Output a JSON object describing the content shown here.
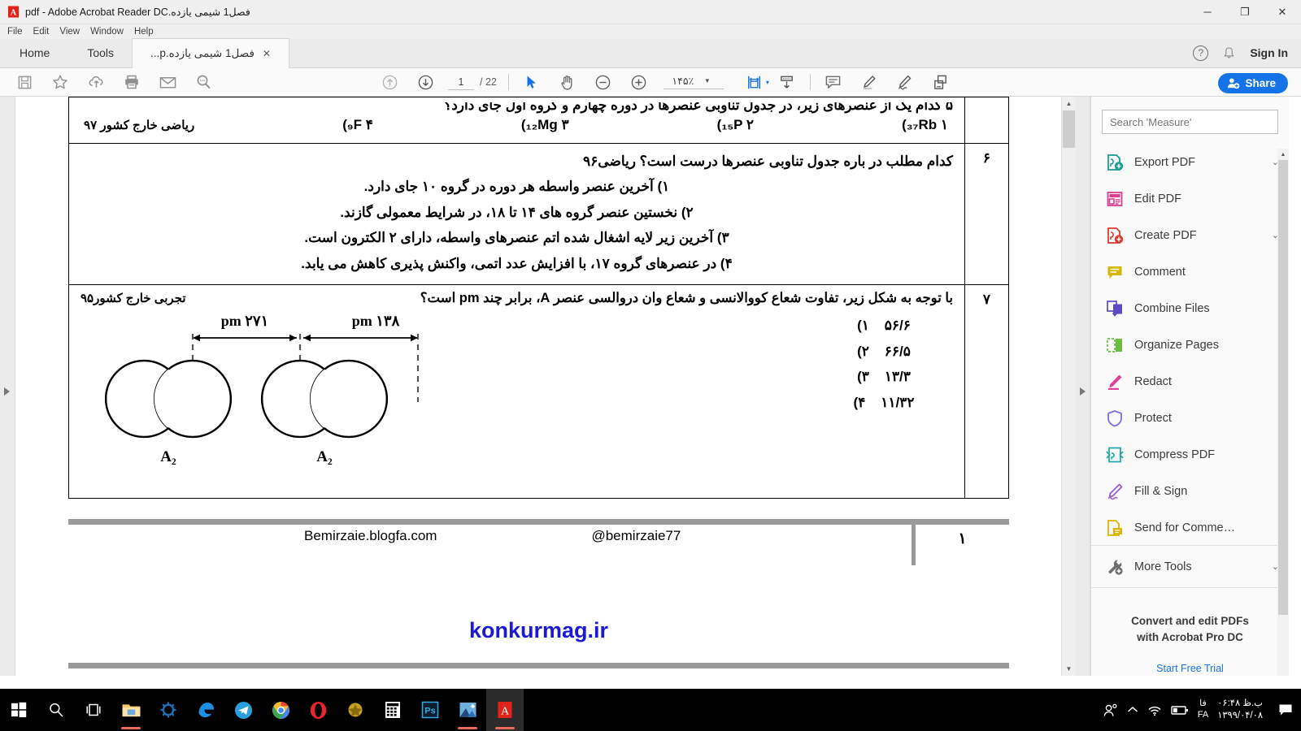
{
  "window": {
    "title": "فصل1 شیمی یازده.pdf - Adobe Acrobat Reader DC",
    "app_icon": "acrobat-icon",
    "minimize": "─",
    "maximize": "❐",
    "close": "✕"
  },
  "menubar": {
    "items": [
      "File",
      "Edit",
      "View",
      "Window",
      "Help"
    ]
  },
  "tabs": {
    "home": "Home",
    "tools": "Tools",
    "document": "فصل1 شیمی یازده.p...",
    "close_glyph": "✕",
    "help_glyph": "?",
    "bell_glyph": "🔔",
    "sign_in": "Sign In"
  },
  "toolbar": {
    "left_icons": [
      "save-icon",
      "star-icon",
      "cloud-upload-icon",
      "print-icon",
      "email-icon",
      "search-icon"
    ],
    "page_current": "1",
    "page_total": "/ 22",
    "zoom_value": "۱۴۵٪",
    "zoom_caret": "▼",
    "share_label": "Share",
    "right_icons": [
      "fit-width-icon",
      "scroll-mode-icon",
      "comment-icon",
      "highlight-icon",
      "sign-icon",
      "stamp-icon"
    ]
  },
  "document": {
    "table_rows": [
      {
        "number": "",
        "clipped_text": "۵ کدام یک از عنصرهای زیر، در جدول تناوبی عنصرها در دوره چهارم و گروه اول جای دارد؟",
        "options": [
          {
            "label": "۱)",
            "text": "₃₇Rb"
          },
          {
            "label": "۲)",
            "text": "₁₅P"
          },
          {
            "label": "۳)",
            "text": "₁₂Mg"
          },
          {
            "label": "۴)",
            "text": "₉F"
          }
        ],
        "source": "ریاضی خارج کشور ۹۷"
      },
      {
        "number": "۶",
        "question": "کدام مطلب در باره جدول تناوبی عنصرها درست است؟ ریاضی۹۶",
        "lines": [
          "۱) آخرین عنصر واسطه هر دوره در گروه ۱۰ جای دارد.",
          "۲) نخستین عنصر گروه های ۱۴ تا ۱۸، در شرایط معمولی گازند.",
          "۳) آخرین زیر لایه اشغال شده اتم عنصرهای واسطه، دارای ۲ الکترون است.",
          "۴) در عنصرهای گروه ۱۷، با افزایش عدد اتمی، واکنش پذیری کاهش می یابد."
        ]
      },
      {
        "number": "۷",
        "question": "با توجه به شکل زیر، تفاوت شعاع کووالانسی و شعاع وان دروالسی عنصر A، برابر چند pm است؟",
        "source": "تجربی خارج کشور۹۵",
        "options": [
          {
            "label": "۱)",
            "text": "۵۶/۶"
          },
          {
            "label": "۲)",
            "text": "۶۶/۵"
          },
          {
            "label": "۳)",
            "text": "۱۳/۳"
          },
          {
            "label": "۴)",
            "text": "۱۱/۳۲"
          }
        ],
        "figure": {
          "dim_left": "۲۷۱ pm",
          "dim_right": "۱۳۸ pm",
          "label_left": "A₂",
          "label_right": "A₂"
        }
      }
    ],
    "footer": {
      "page_number": "۱",
      "site": "Bemirzaie.blogfa.com",
      "handle": "@bemirzaie77"
    },
    "brand": "konkurmag.ir"
  },
  "right_panel": {
    "search_placeholder": "Search 'Measure'",
    "tools": [
      {
        "label": "Export PDF",
        "icon": "export-pdf-icon",
        "color": "#1a9b94",
        "chevron": "⌄"
      },
      {
        "label": "Edit PDF",
        "icon": "edit-pdf-icon",
        "color": "#d93d8f",
        "chevron": ""
      },
      {
        "label": "Create PDF",
        "icon": "create-pdf-icon",
        "color": "#e0392e",
        "chevron": "⌄"
      },
      {
        "label": "Comment",
        "icon": "comment-icon",
        "color": "#d6b700",
        "chevron": ""
      },
      {
        "label": "Combine Files",
        "icon": "combine-files-icon",
        "color": "#5b4bc4",
        "chevron": ""
      },
      {
        "label": "Organize Pages",
        "icon": "organize-pages-icon",
        "color": "#6cbf3e",
        "chevron": ""
      },
      {
        "label": "Redact",
        "icon": "redact-icon",
        "color": "#e0409a",
        "chevron": ""
      },
      {
        "label": "Protect",
        "icon": "protect-icon",
        "color": "#7b6fe0",
        "chevron": ""
      },
      {
        "label": "Compress PDF",
        "icon": "compress-pdf-icon",
        "color": "#1aa6a6",
        "chevron": ""
      },
      {
        "label": "Fill & Sign",
        "icon": "fill-sign-icon",
        "color": "#9b5bd6",
        "chevron": ""
      },
      {
        "label": "Send for Comme…",
        "icon": "send-comments-icon",
        "color": "#e0b400",
        "chevron": ""
      },
      {
        "label": "More Tools",
        "icon": "more-tools-icon",
        "color": "#6e6e6e",
        "chevron": "⌄"
      }
    ],
    "promo_line1": "Convert and edit PDFs",
    "promo_line2": "with Acrobat Pro DC",
    "promo_link": "Start Free Trial"
  },
  "taskbar": {
    "apps": [
      {
        "name": "start-button",
        "glyph": "⊞",
        "color": "#ffffff",
        "underline": ""
      },
      {
        "name": "search-button",
        "glyph": "🔍",
        "color": "#ffffff",
        "underline": ""
      },
      {
        "name": "task-view-button",
        "glyph": "❏",
        "color": "#ffffff",
        "underline": ""
      },
      {
        "name": "file-explorer",
        "glyph": "📁",
        "color": "#ffce4f",
        "underline": "#e86a5a"
      },
      {
        "name": "gear-app",
        "glyph": "⚙",
        "color": "#1f6fb4",
        "underline": ""
      },
      {
        "name": "edge-browser",
        "glyph": "e",
        "color": "#1a8fe3",
        "underline": ""
      },
      {
        "name": "telegram-app",
        "glyph": "✈",
        "color": "#29a0dd",
        "underline": ""
      },
      {
        "name": "chrome-browser",
        "glyph": "◉",
        "color": "#4fae4f",
        "underline": "#e86a5a"
      },
      {
        "name": "opera-browser",
        "glyph": "O",
        "color": "#e8252a",
        "underline": ""
      },
      {
        "name": "game-app",
        "glyph": "✹",
        "color": "#c8a020",
        "underline": ""
      },
      {
        "name": "calculator-app",
        "glyph": "▦",
        "color": "#ffffff",
        "underline": ""
      },
      {
        "name": "photoshop-app",
        "glyph": "Ps",
        "color": "#31a8e0",
        "underline": ""
      },
      {
        "name": "photos-app",
        "glyph": "🖼",
        "color": "#2f6fb4",
        "underline": "#e86a5a"
      },
      {
        "name": "acrobat-app",
        "glyph": "A",
        "color": "#e2231a",
        "underline": "#e86a5a"
      }
    ],
    "tray": {
      "people_icon": "people-icon",
      "chevron": "⌃",
      "wifi": "wifi-icon",
      "battery": "battery-icon",
      "lang_fa": "فا",
      "lang_en": "FA",
      "time": "۰۶:۴۸ ب.ظ",
      "date": "۱۳۹۹/۰۴/۰۸",
      "action_center": "action-center-icon"
    }
  }
}
